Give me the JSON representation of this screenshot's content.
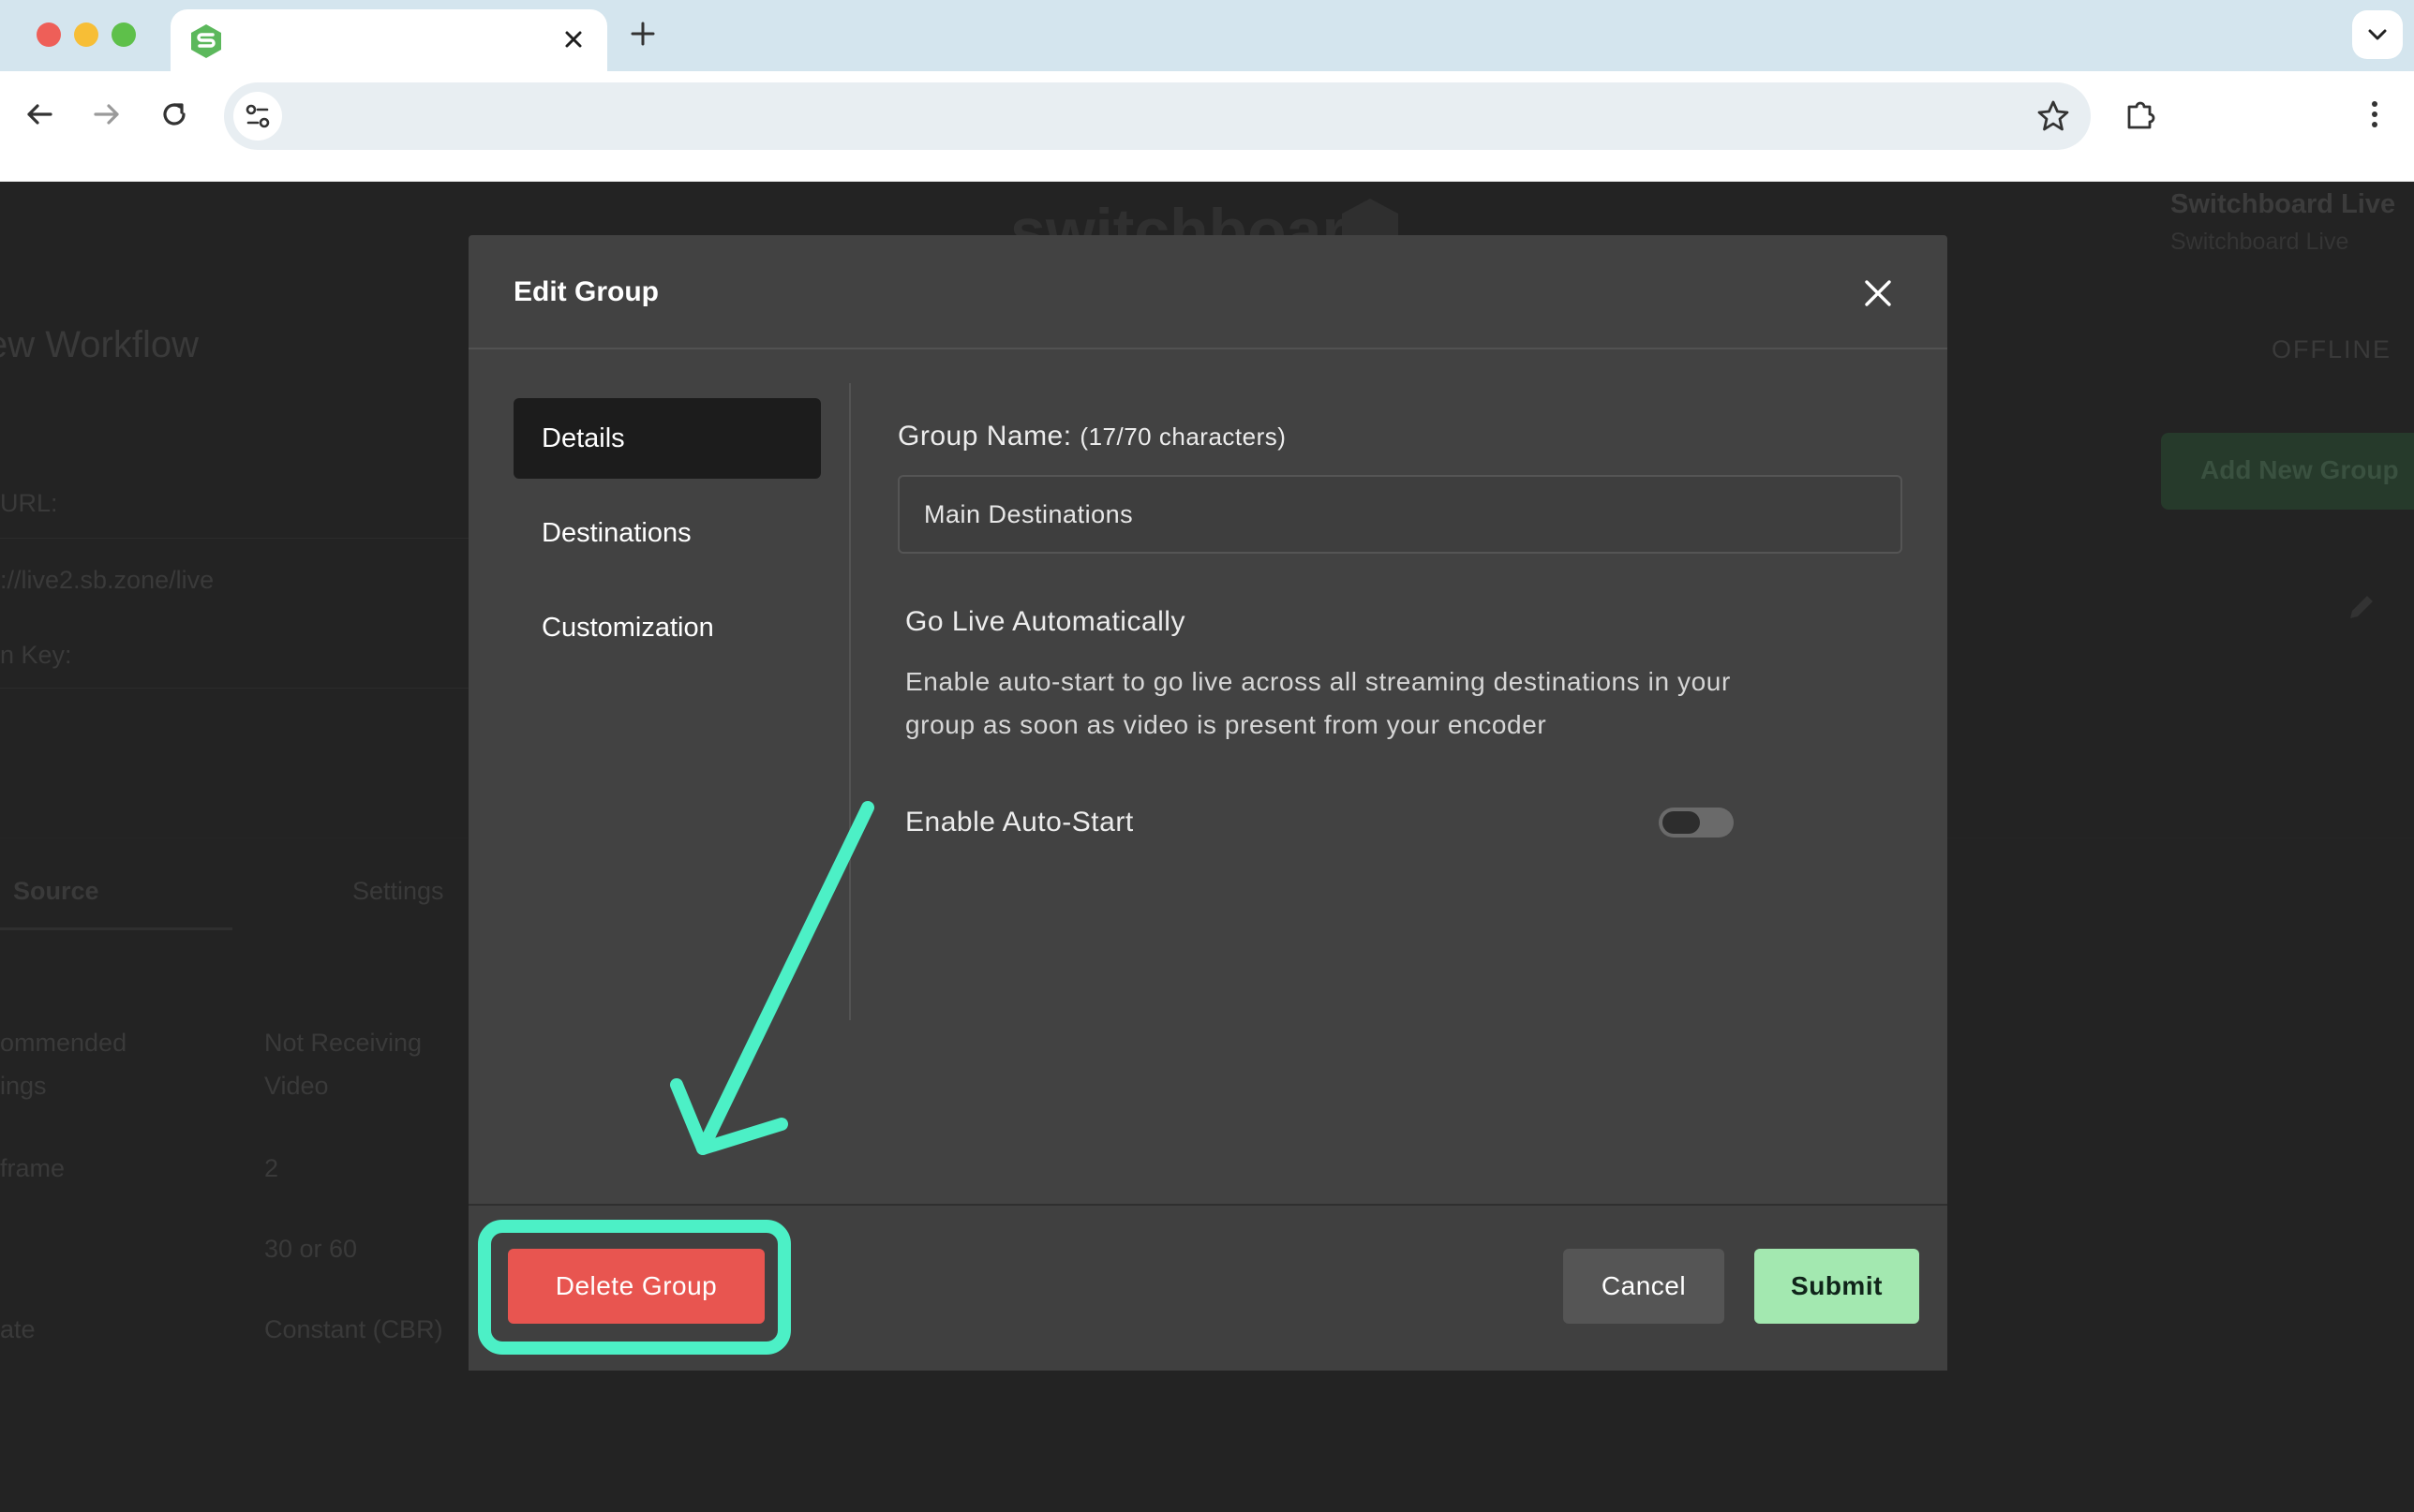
{
  "browser": {
    "tab_title": "",
    "address": "",
    "favicon": "switchboard-logo-icon",
    "tab_close_icon": "close-icon",
    "new_tab_icon": "plus-icon",
    "tab_menu_icon": "chevron-down-icon",
    "nav_icons": [
      "back-arrow-icon",
      "forward-arrow-icon",
      "reload-icon",
      "site-info-icon",
      "star-icon",
      "extensions-icon",
      "more-vert-icon"
    ]
  },
  "background_page": {
    "logo_text": "switchboard",
    "account_name": "Switchboard Live",
    "account_sub": "Switchboard Live",
    "workflow_title": "ew Workflow",
    "status": "OFFLINE",
    "add_group_button": "Add New Group",
    "url_label": "URL:",
    "url_value": "://live2.sb.zone/live",
    "key_label": "n Key:",
    "key_value": "",
    "tab_source": "Source",
    "tab_settings": "Settings",
    "rows": [
      {
        "label_line1": "ommended",
        "label_line2": "ings",
        "value_line1": "Not Receiving",
        "value_line2": "Video"
      },
      {
        "label_line1": "frame",
        "label_line2": "",
        "value_line1": "2",
        "value_line2": ""
      },
      {
        "label_line1": "",
        "label_line2": "",
        "value_line1": "30 or 60",
        "value_line2": ""
      },
      {
        "label_line1": "ate",
        "label_line2": "",
        "value_line1": "Constant (CBR)",
        "value_line2": ""
      }
    ]
  },
  "modal": {
    "title": "Edit Group",
    "close_icon": "close-icon",
    "sidebar": [
      {
        "label": "Details",
        "active": true
      },
      {
        "label": "Destinations",
        "active": false
      },
      {
        "label": "Customization",
        "active": false
      }
    ],
    "group_name": {
      "label": "Group Name:",
      "count": "(17/70 characters)",
      "value": "Main Destinations"
    },
    "go_live": {
      "title": "Go Live Automatically",
      "description": "Enable auto-start to go live across all streaming destinations in your group as soon as video is present from your encoder"
    },
    "auto_start": {
      "label": "Enable Auto-Start",
      "enabled": false
    },
    "footer": {
      "delete_label": "Delete Group",
      "cancel_label": "Cancel",
      "submit_label": "Submit"
    }
  },
  "annotation": {
    "color": "#4cf0c6",
    "target": "delete-group-button"
  }
}
